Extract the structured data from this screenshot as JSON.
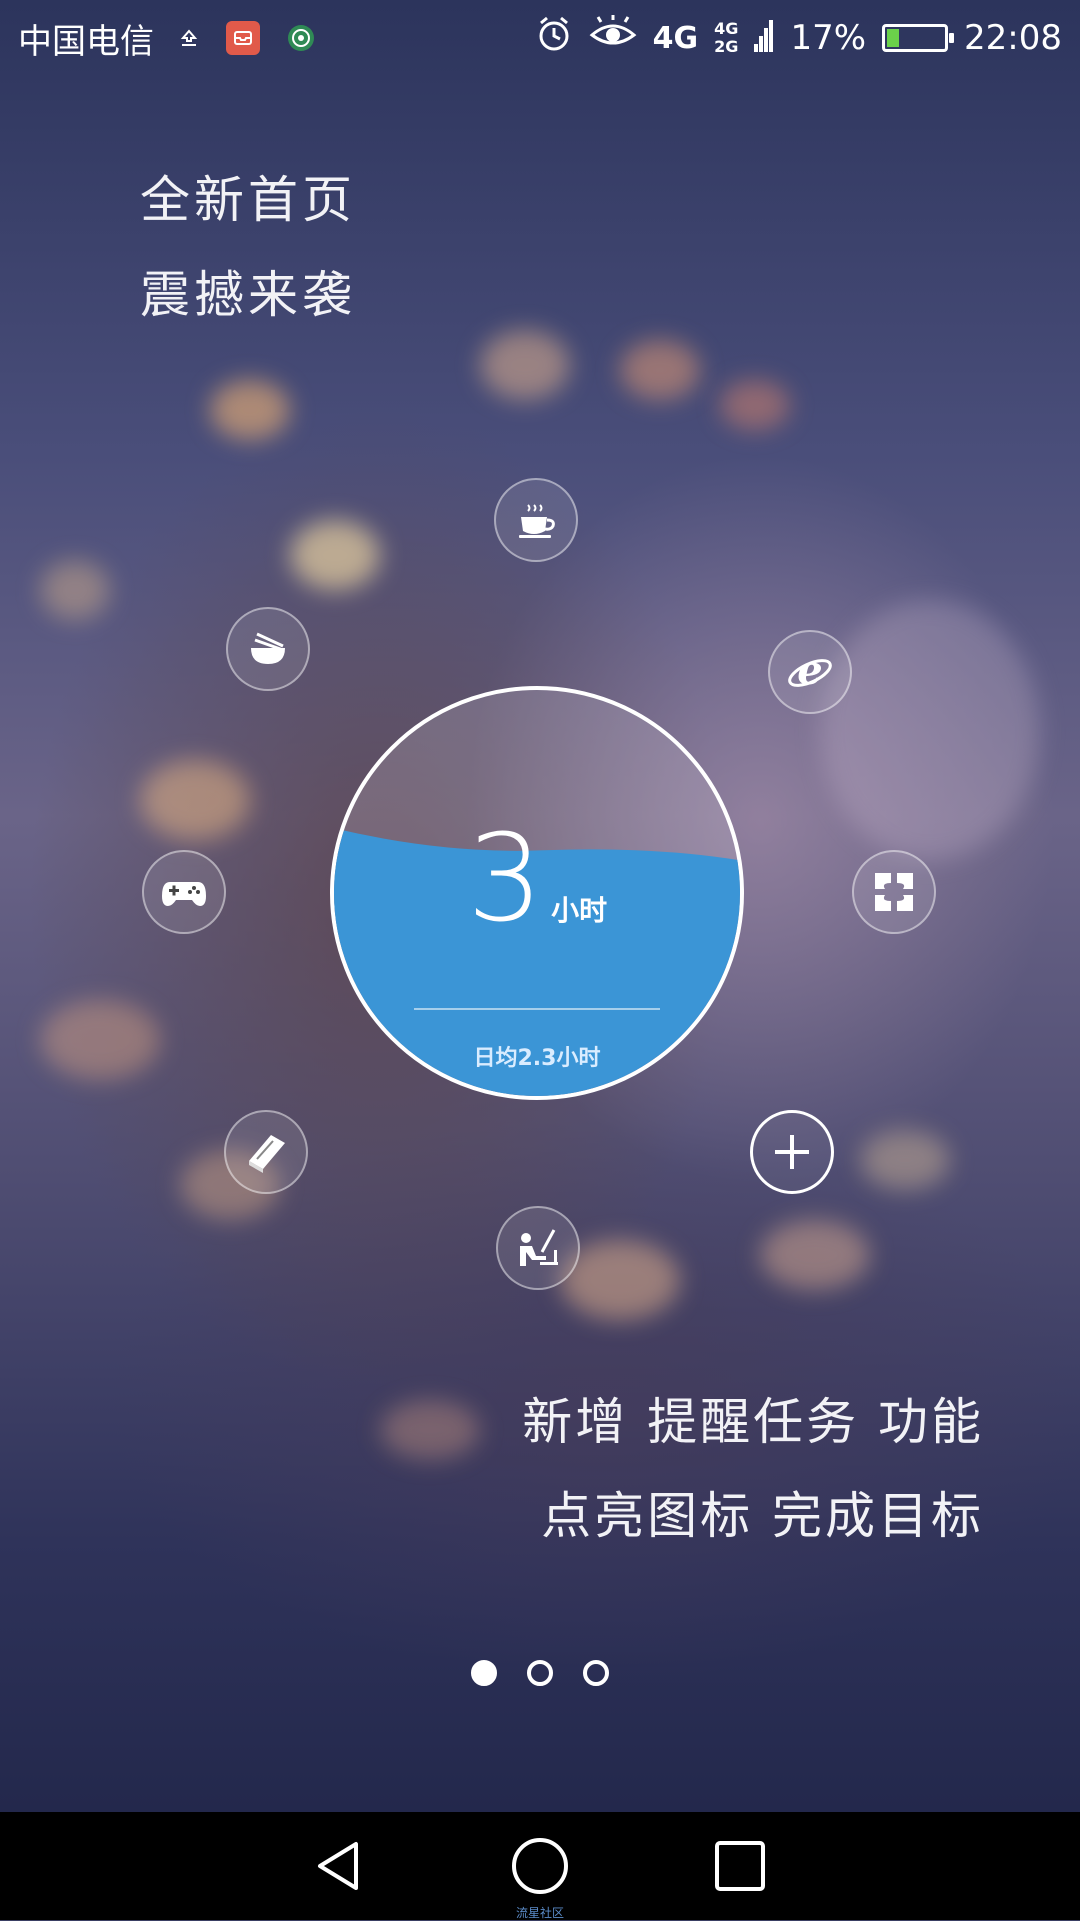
{
  "status_bar": {
    "carrier": "中国电信",
    "network_1": "4G",
    "network_2_top": "4G",
    "network_2_bottom": "2G",
    "battery_percent": "17%",
    "time": "22:08",
    "icons": [
      "upload-icon",
      "mail-app-icon",
      "android-icon",
      "alarm-icon",
      "eye-icon",
      "signal-icon",
      "battery-charging-icon"
    ]
  },
  "headline": {
    "line1": "全新首页",
    "line2": "震撼来袭"
  },
  "dial": {
    "value": "3",
    "unit": "小时",
    "average": "日均2.3小时",
    "fill_level": 0.62,
    "fill_color": "#3b95d6"
  },
  "orbit_icons": [
    "coffee-icon",
    "browser-icon",
    "noodles-icon",
    "apps-icon",
    "gamepad-icon",
    "book-icon",
    "study-icon",
    "add-icon"
  ],
  "promo": {
    "line1": "新增 提醒任务 功能",
    "line2": "点亮图标  完成目标"
  },
  "pager": {
    "pages": 3,
    "active_index": 0
  },
  "nav_bar": {
    "buttons": [
      "back-icon",
      "home-icon",
      "recents-icon"
    ]
  },
  "watermark": "流星社区"
}
